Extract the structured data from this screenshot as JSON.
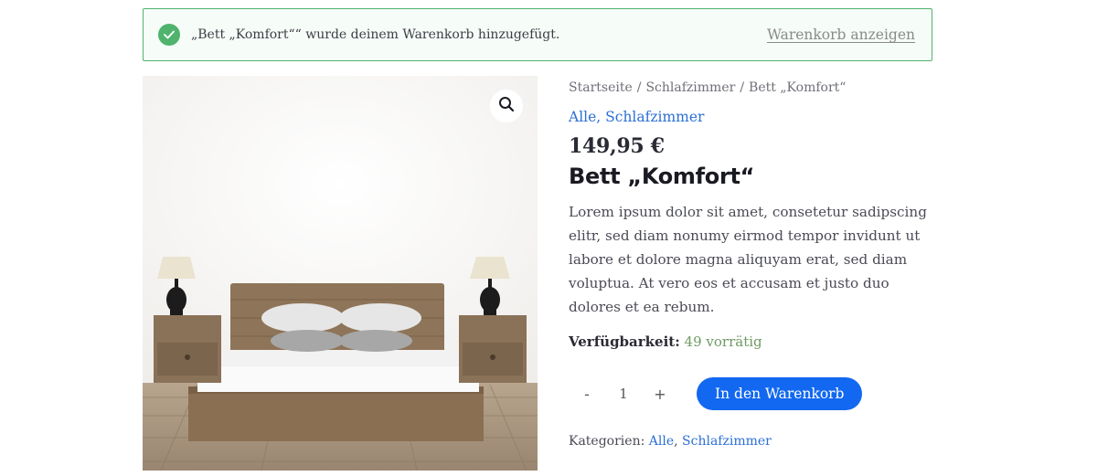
{
  "notice": {
    "message": "„Bett „Komfort““ wurde deinem Warenkorb hinzugefügt.",
    "link_label": "Warenkorb anzeigen",
    "icon": "check-icon",
    "border_color": "#4fb36e"
  },
  "image": {
    "zoom_icon": "magnifier-icon"
  },
  "breadcrumb": {
    "items": [
      "Startseite",
      "Schlafzimmer",
      "Bett „Komfort“"
    ],
    "separator": "/"
  },
  "categories_top": {
    "items": [
      "Alle",
      "Schlafzimmer"
    ],
    "separator": ", "
  },
  "product": {
    "price": "149,95 €",
    "title": "Bett „Komfort“",
    "description": "Lorem ipsum dolor sit amet, consetetur sadipscing elitr, sed diam nonumy eirmod tempor invidunt ut labore et dolore magna aliquyam erat, sed diam voluptua. At vero eos et accusam et justo duo dolores et ea rebum.",
    "availability_label": "Verfügbarkeit:",
    "availability_value": "49 vorrätig"
  },
  "cart": {
    "minus": "-",
    "quantity": "1",
    "plus": "+",
    "add_label": "In den Warenkorb",
    "accent": "#1268f0"
  },
  "categories_bottom": {
    "label": "Kategorien: ",
    "items": [
      "Alle",
      "Schlafzimmer"
    ],
    "separator": ", "
  }
}
